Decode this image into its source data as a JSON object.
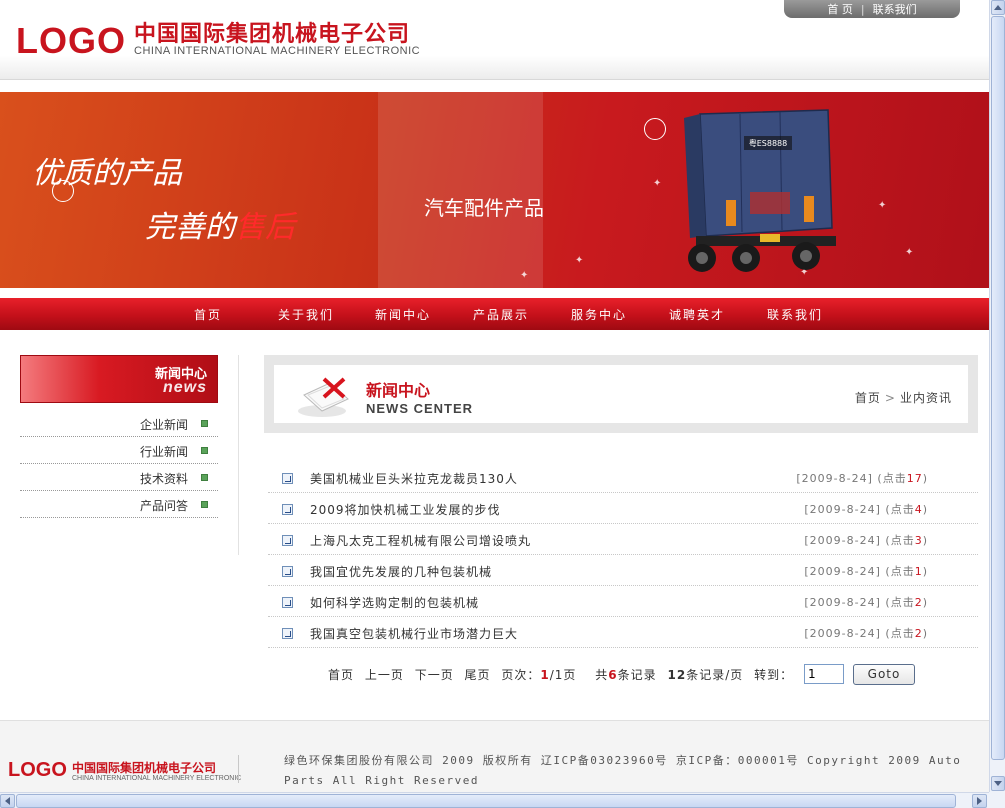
{
  "header": {
    "logo": "LOGO",
    "company_cn": "中国国际集团机械电子公司",
    "company_en": "CHINA INTERNATIONAL MACHINERY ELECTRONIC",
    "top_links": [
      "首 页",
      "联系我们"
    ],
    "top_sep": "|"
  },
  "banner": {
    "slogan_line1": "优质的产品",
    "slogan_line2_a": "完善的",
    "slogan_line2_b": "售后",
    "title": "汽车配件产品",
    "plate": "粤ES8888"
  },
  "nav": {
    "items": [
      "首页",
      "关于我们",
      "新闻中心",
      "产品展示",
      "服务中心",
      "诚聘英才",
      "联系我们"
    ]
  },
  "sidebar": {
    "title_cn": "新闻中心",
    "title_en": "news",
    "items": [
      "企业新闻",
      "行业新闻",
      "技术资料",
      "产品问答"
    ]
  },
  "main": {
    "title_cn": "新闻中心",
    "title_en": "NEWS CENTER",
    "breadcrumb": [
      "首页",
      "业内资讯"
    ],
    "breadcrumb_sep": ">",
    "news": [
      {
        "title": "美国机械业巨头米拉克龙裁员130人",
        "date": "[2009-8-24]",
        "clicks_prefix": "(点击",
        "clicks": "17",
        "clicks_suffix": ")"
      },
      {
        "title": "2009将加快机械工业发展的步伐",
        "date": "[2009-8-24]",
        "clicks_prefix": "(点击",
        "clicks": "4",
        "clicks_suffix": ")"
      },
      {
        "title": "上海凡太克工程机械有限公司增设喷丸",
        "date": "[2009-8-24]",
        "clicks_prefix": "(点击",
        "clicks": "3",
        "clicks_suffix": ")"
      },
      {
        "title": "我国宜优先发展的几种包装机械",
        "date": "[2009-8-24]",
        "clicks_prefix": "(点击",
        "clicks": "1",
        "clicks_suffix": ")"
      },
      {
        "title": "如何科学选购定制的包装机械",
        "date": "[2009-8-24]",
        "clicks_prefix": "(点击",
        "clicks": "2",
        "clicks_suffix": ")"
      },
      {
        "title": "我国真空包装机械行业市场潜力巨大",
        "date": "[2009-8-24]",
        "clicks_prefix": "(点击",
        "clicks": "2",
        "clicks_suffix": ")"
      }
    ]
  },
  "pager": {
    "first": "首页",
    "prev": "上一页",
    "next": "下一页",
    "last": "尾页",
    "page_label": "页次：",
    "page_current": "1",
    "page_total": "/1页",
    "total_prefix": "共",
    "total_count": "6",
    "total_suffix": "条记录",
    "per_page": "12",
    "per_page_suffix": "条记录/页",
    "goto_label": "转到：",
    "goto_value": "1",
    "goto_button": "Goto"
  },
  "footer": {
    "logo": "LOGO",
    "company_cn": "中国国际集团机械电子公司",
    "company_en": "CHINA INTERNATIONAL MACHINERY ELECTRONIC",
    "copyright": "绿色环保集团股份有限公司 2009 版权所有 辽ICP备03023960号 京ICP备：000001号 Copyright 2009 Auto Parts All Right Reserved"
  },
  "colors": {
    "brand_red": "#c8141e",
    "banner_red": "#c81a1e",
    "bullet_green": "#5aa35a"
  }
}
